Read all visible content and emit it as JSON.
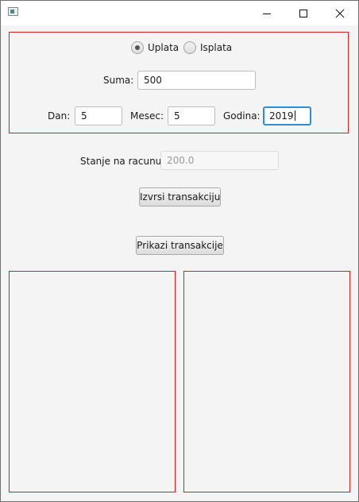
{
  "window": {
    "title": "",
    "controls": [
      "minimize-icon",
      "maximize-icon",
      "close-icon"
    ]
  },
  "transaction_type": {
    "options": [
      {
        "label": "Uplata",
        "selected": true
      },
      {
        "label": "Isplata",
        "selected": false
      }
    ]
  },
  "amount": {
    "label": "Suma:",
    "value": "500"
  },
  "date": {
    "day_label": "Dan:",
    "day_value": "5",
    "month_label": "Mesec:",
    "month_value": "5",
    "year_label": "Godina:",
    "year_value": "2019"
  },
  "balance": {
    "label": "Stanje na racunu:",
    "value": "200.0"
  },
  "buttons": {
    "execute_label": "Izvrsi transakciju",
    "show_label": "Prikazi transakcije"
  },
  "colors": {
    "panel_border": "#d02020",
    "focus": "#2d8ed3"
  }
}
